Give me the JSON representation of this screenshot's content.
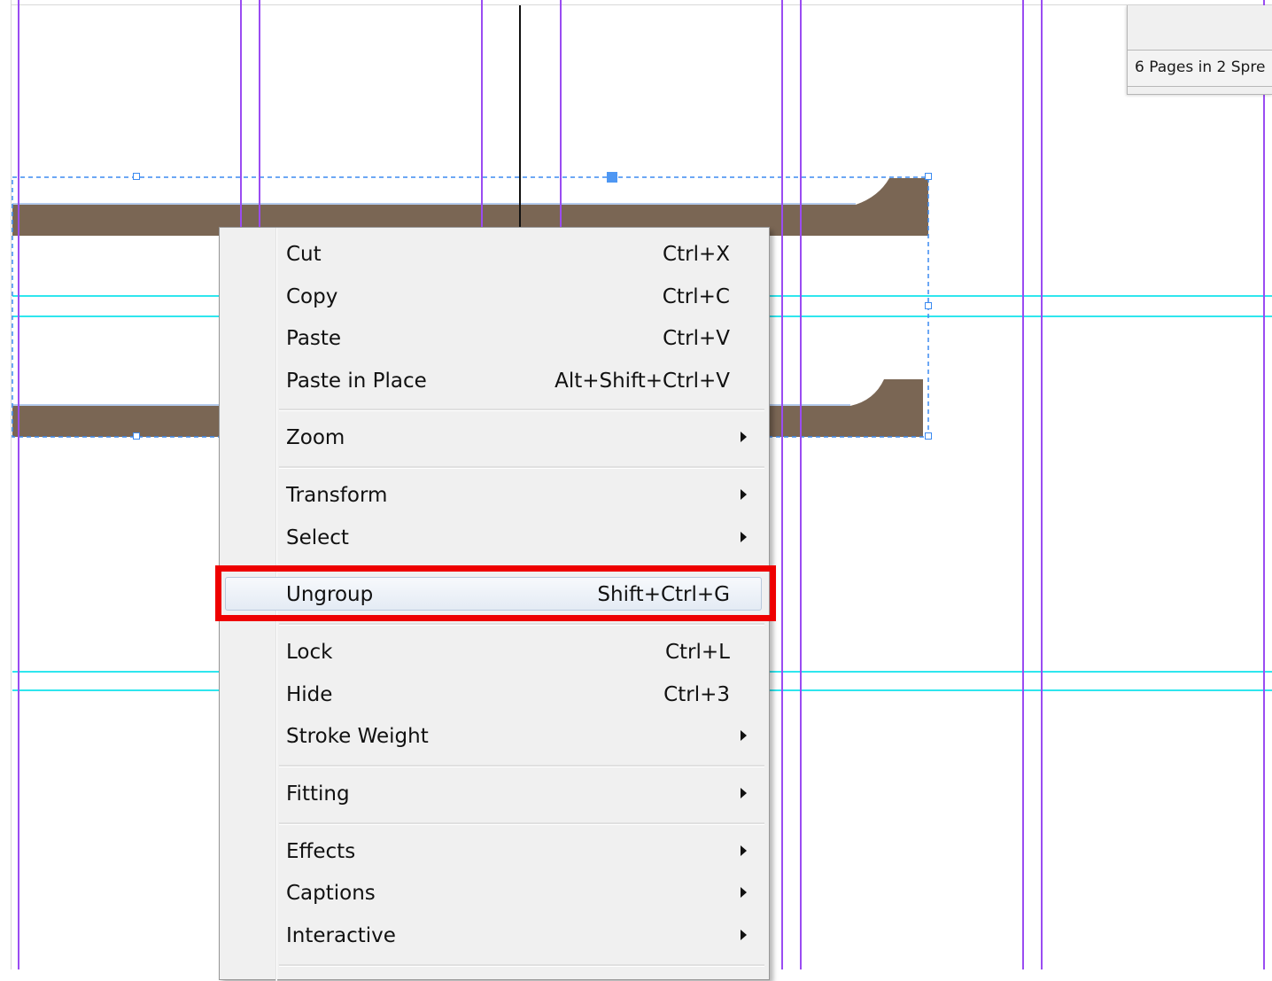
{
  "pages_panel": {
    "status_text": "6 Pages in 2 Spre"
  },
  "context_menu": {
    "items": [
      {
        "label": "Cut",
        "shortcut": "Ctrl+X"
      },
      {
        "label": "Copy",
        "shortcut": "Ctrl+C"
      },
      {
        "label": "Paste",
        "shortcut": "Ctrl+V"
      },
      {
        "label": "Paste in Place",
        "shortcut": "Alt+Shift+Ctrl+V"
      },
      {
        "label": "Zoom",
        "submenu": true
      },
      {
        "label": "Transform",
        "submenu": true
      },
      {
        "label": "Select",
        "submenu": true
      },
      {
        "label": "Ungroup",
        "shortcut": "Shift+Ctrl+G",
        "highlighted": true
      },
      {
        "label": "Lock",
        "shortcut": "Ctrl+L"
      },
      {
        "label": "Hide",
        "shortcut": "Ctrl+3"
      },
      {
        "label": "Stroke Weight",
        "submenu": true
      },
      {
        "label": "Fitting",
        "submenu": true
      },
      {
        "label": "Effects",
        "submenu": true
      },
      {
        "label": "Captions",
        "submenu": true
      },
      {
        "label": "Interactive",
        "submenu": true
      }
    ]
  },
  "colors": {
    "shape_fill": "#7a6654",
    "margin_guide": "#9a4cf2",
    "ruler_guide": "#2fe6ee",
    "selection": "#3b8af0",
    "highlight_border": "#ee0000"
  }
}
